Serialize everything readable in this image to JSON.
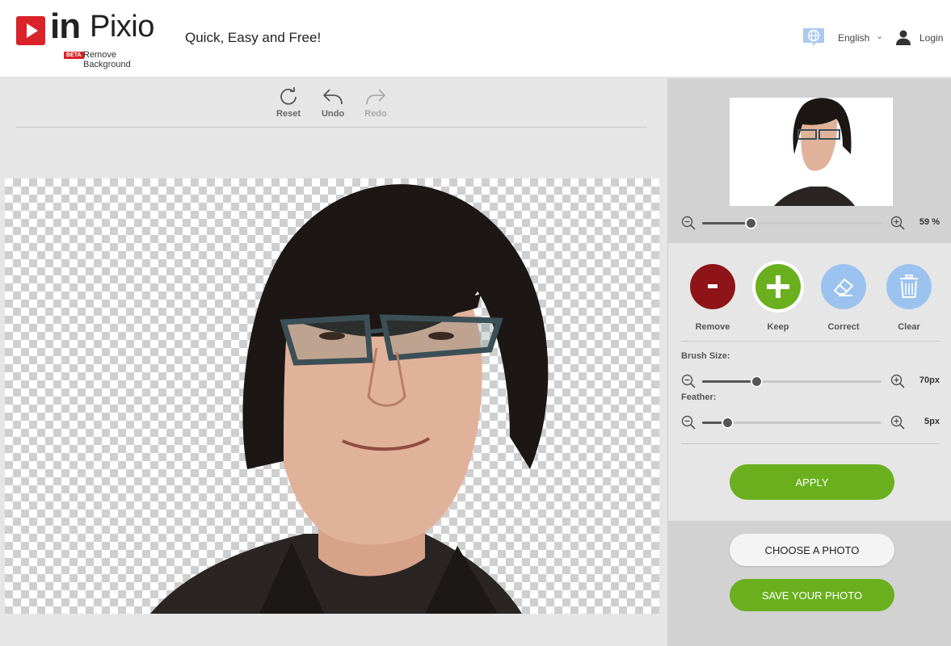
{
  "header": {
    "logo_in": "in",
    "logo_pixio": "Pixio",
    "logo_beta": "BETA",
    "logo_sub": "Remove Background",
    "tagline": "Quick, Easy and Free!",
    "language": "English",
    "login": "Login"
  },
  "toolbar": {
    "reset": "Reset",
    "undo": "Undo",
    "redo": "Redo"
  },
  "sidebar": {
    "zoom": {
      "value": 0.27,
      "label": "59 %"
    },
    "tools": {
      "remove": "Remove",
      "keep": "Keep",
      "correct": "Correct",
      "clear": "Clear"
    },
    "brush": {
      "label": "Brush Size:",
      "value": 0.3,
      "display": "70px"
    },
    "feather": {
      "label": "Feather:",
      "value": 0.14,
      "display": "5px"
    },
    "apply": "APPLY",
    "choose": "CHOOSE A PHOTO",
    "save": "SAVE YOUR PHOTO"
  },
  "colors": {
    "brand_red": "#d9222a",
    "remove_red": "#8e1418",
    "keep_green": "#6ab01e",
    "tool_blue": "#9cc3ef",
    "button_green": "#6ab01e"
  },
  "icons": [
    "play-logo-icon",
    "language-globe-icon",
    "chevron-down-icon",
    "user-icon",
    "reset-icon",
    "undo-icon",
    "redo-icon",
    "zoom-out-icon",
    "zoom-in-icon",
    "minus-icon",
    "plus-icon",
    "eraser-icon",
    "trash-icon"
  ]
}
